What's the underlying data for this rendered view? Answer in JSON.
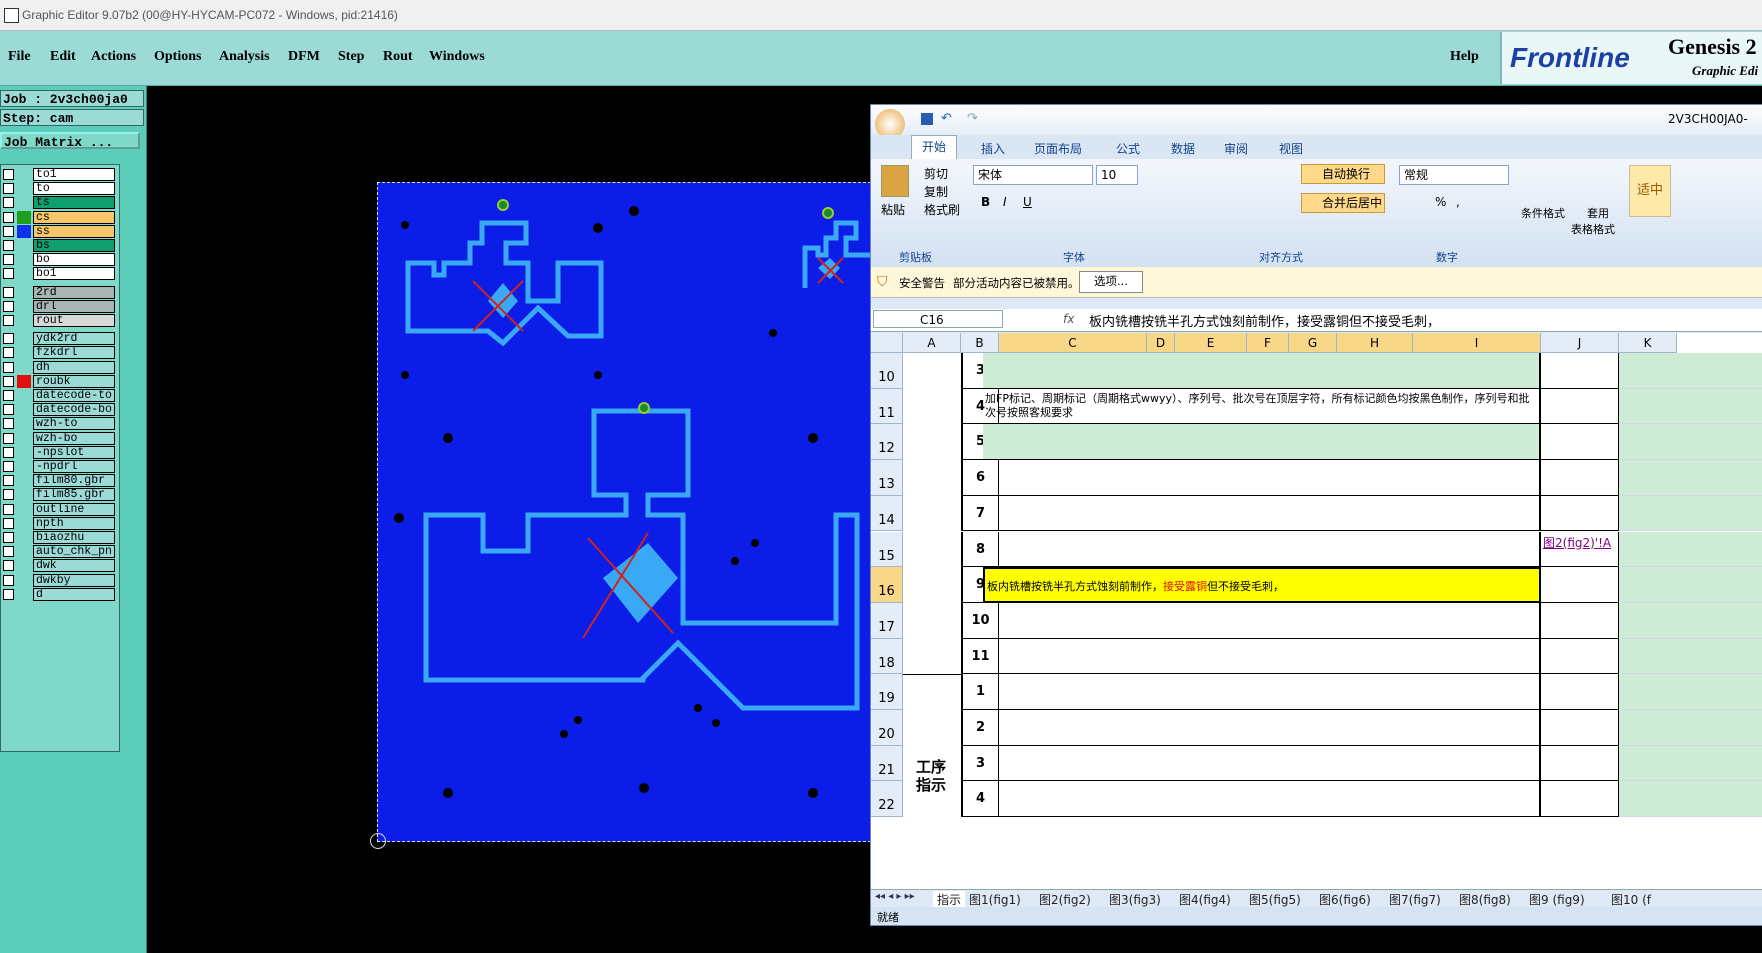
{
  "window": {
    "title": "Graphic Editor 9.07b2 (00@HY-HYCAM-PC072 - Windows, pid:21416)"
  },
  "menu": {
    "items": [
      "File",
      "Edit",
      "Actions",
      "Options",
      "Analysis",
      "DFM",
      "Step",
      "Rout",
      "Windows"
    ],
    "help": "Help"
  },
  "logo": {
    "brand": "Frontline",
    "product": "Genesis 2",
    "sub": "Graphic Edi"
  },
  "job": {
    "job_label": "Job : 2v3ch00ja0",
    "step_label": "Step: cam",
    "matrix_button": "Job Matrix ..."
  },
  "layers": [
    {
      "name": "to1",
      "bg": "#ffffff",
      "color": ""
    },
    {
      "name": "to",
      "bg": "#ffffff",
      "color": ""
    },
    {
      "name": "ts",
      "bg": "#10a070",
      "color": ""
    },
    {
      "name": "cs",
      "bg": "#f5c66a",
      "color": "#1ea01e"
    },
    {
      "name": "ss",
      "bg": "#f5c66a",
      "color": "#1030f0"
    },
    {
      "name": "bs",
      "bg": "#10a070",
      "color": ""
    },
    {
      "name": "bo",
      "bg": "#ffffff",
      "color": ""
    },
    {
      "name": "bo1",
      "bg": "#ffffff",
      "color": ""
    },
    {
      "name": "2rd",
      "bg": "#a8b4b4",
      "color": ""
    },
    {
      "name": "drl",
      "bg": "#a8b4b4",
      "color": ""
    },
    {
      "name": "rout",
      "bg": "#d8d8d8",
      "color": ""
    },
    {
      "name": "ydk2rd",
      "bg": "#9bdad5",
      "color": ""
    },
    {
      "name": "fzkdrl",
      "bg": "#9bdad5",
      "color": ""
    },
    {
      "name": "dh",
      "bg": "#9bdad5",
      "color": ""
    },
    {
      "name": "roubk",
      "bg": "#9bdad5",
      "color": "#e01010"
    },
    {
      "name": "datecode-to",
      "bg": "#9bdad5",
      "color": ""
    },
    {
      "name": "datecode-bo",
      "bg": "#9bdad5",
      "color": ""
    },
    {
      "name": "wzh-to",
      "bg": "#9bdad5",
      "color": ""
    },
    {
      "name": "wzh-bo",
      "bg": "#9bdad5",
      "color": ""
    },
    {
      "name": "-npslot",
      "bg": "#9bdad5",
      "color": ""
    },
    {
      "name": "-npdrl",
      "bg": "#9bdad5",
      "color": ""
    },
    {
      "name": "film80.gbr",
      "bg": "#9bdad5",
      "color": ""
    },
    {
      "name": "film85.gbr",
      "bg": "#9bdad5",
      "color": ""
    },
    {
      "name": "outline",
      "bg": "#9bdad5",
      "color": ""
    },
    {
      "name": "npth",
      "bg": "#9bdad5",
      "color": ""
    },
    {
      "name": "biaozhu",
      "bg": "#9bdad5",
      "color": ""
    },
    {
      "name": "auto_chk_pn.",
      "bg": "#9bdad5",
      "color": ""
    },
    {
      "name": "dwk",
      "bg": "#9bdad5",
      "color": ""
    },
    {
      "name": "dwkby",
      "bg": "#9bdad5",
      "color": ""
    },
    {
      "name": "d",
      "bg": "#9bdad5",
      "color": ""
    }
  ],
  "excel": {
    "title": "2V3CH00JA0-",
    "tabs": [
      "开始",
      "插入",
      "页面布局",
      "公式",
      "数据",
      "审阅",
      "视图"
    ],
    "clipboard": {
      "paste": "粘贴",
      "cut": "剪切",
      "copy": "复制",
      "format_painter": "格式刷",
      "group": "剪贴板"
    },
    "font": {
      "name": "宋体",
      "size": "10",
      "group": "字体",
      "bold": "B",
      "italic": "I",
      "underline": "U"
    },
    "align": {
      "wrap": "自动换行",
      "merge": "合并后居中",
      "group": "对齐方式"
    },
    "number": {
      "format": "常规",
      "group": "数字",
      "percent": "%",
      "comma": ","
    },
    "styles": {
      "cond": "条件格式",
      "table": "套用",
      "table2": "表格格式",
      "fit": "适中"
    },
    "security": {
      "title": "安全警告",
      "msg": "部分活动内容已被禁用。",
      "button": "选项..."
    },
    "namebox": "C16",
    "fx": "fx",
    "formula": "板内铣槽按铣半孔方式蚀刻前制作，接受露铜但不接受毛刺，",
    "columns": [
      "A",
      "B",
      "C",
      "D",
      "E",
      "F",
      "G",
      "H",
      "I",
      "J",
      "K"
    ],
    "rows": [
      "10",
      "11",
      "12",
      "13",
      "14",
      "15",
      "16",
      "17",
      "18",
      "19",
      "20",
      "21",
      "22"
    ],
    "bnums": [
      "3",
      "4",
      "5",
      "6",
      "7",
      "8",
      "9",
      "10",
      "11",
      "1",
      "2",
      "3",
      "4"
    ],
    "row11_text": "加FP标记、周期标记（周期格式wwyy）、序列号、批次号在顶层字符，所有标记颜色均按黑色制作，序列号和批次号按照客规要求",
    "row16_a": "板内铣槽按铣半孔方式蚀刻前制作，",
    "row16_red": "接受露铜",
    "row16_b": "但不接受毛刺，",
    "j15_link": "图2(fig2)'!A",
    "a_label": "工序指示",
    "sheet_tabs": [
      "指示",
      "图1(fig1)",
      "图2(fig2)",
      "图3(fig3)",
      "图4(fig4)",
      "图5(fig5)",
      "图6(fig6)",
      "图7(fig7)",
      "图8(fig8)",
      "图9 (fig9)",
      "图10 (f"
    ],
    "status": "就绪"
  }
}
